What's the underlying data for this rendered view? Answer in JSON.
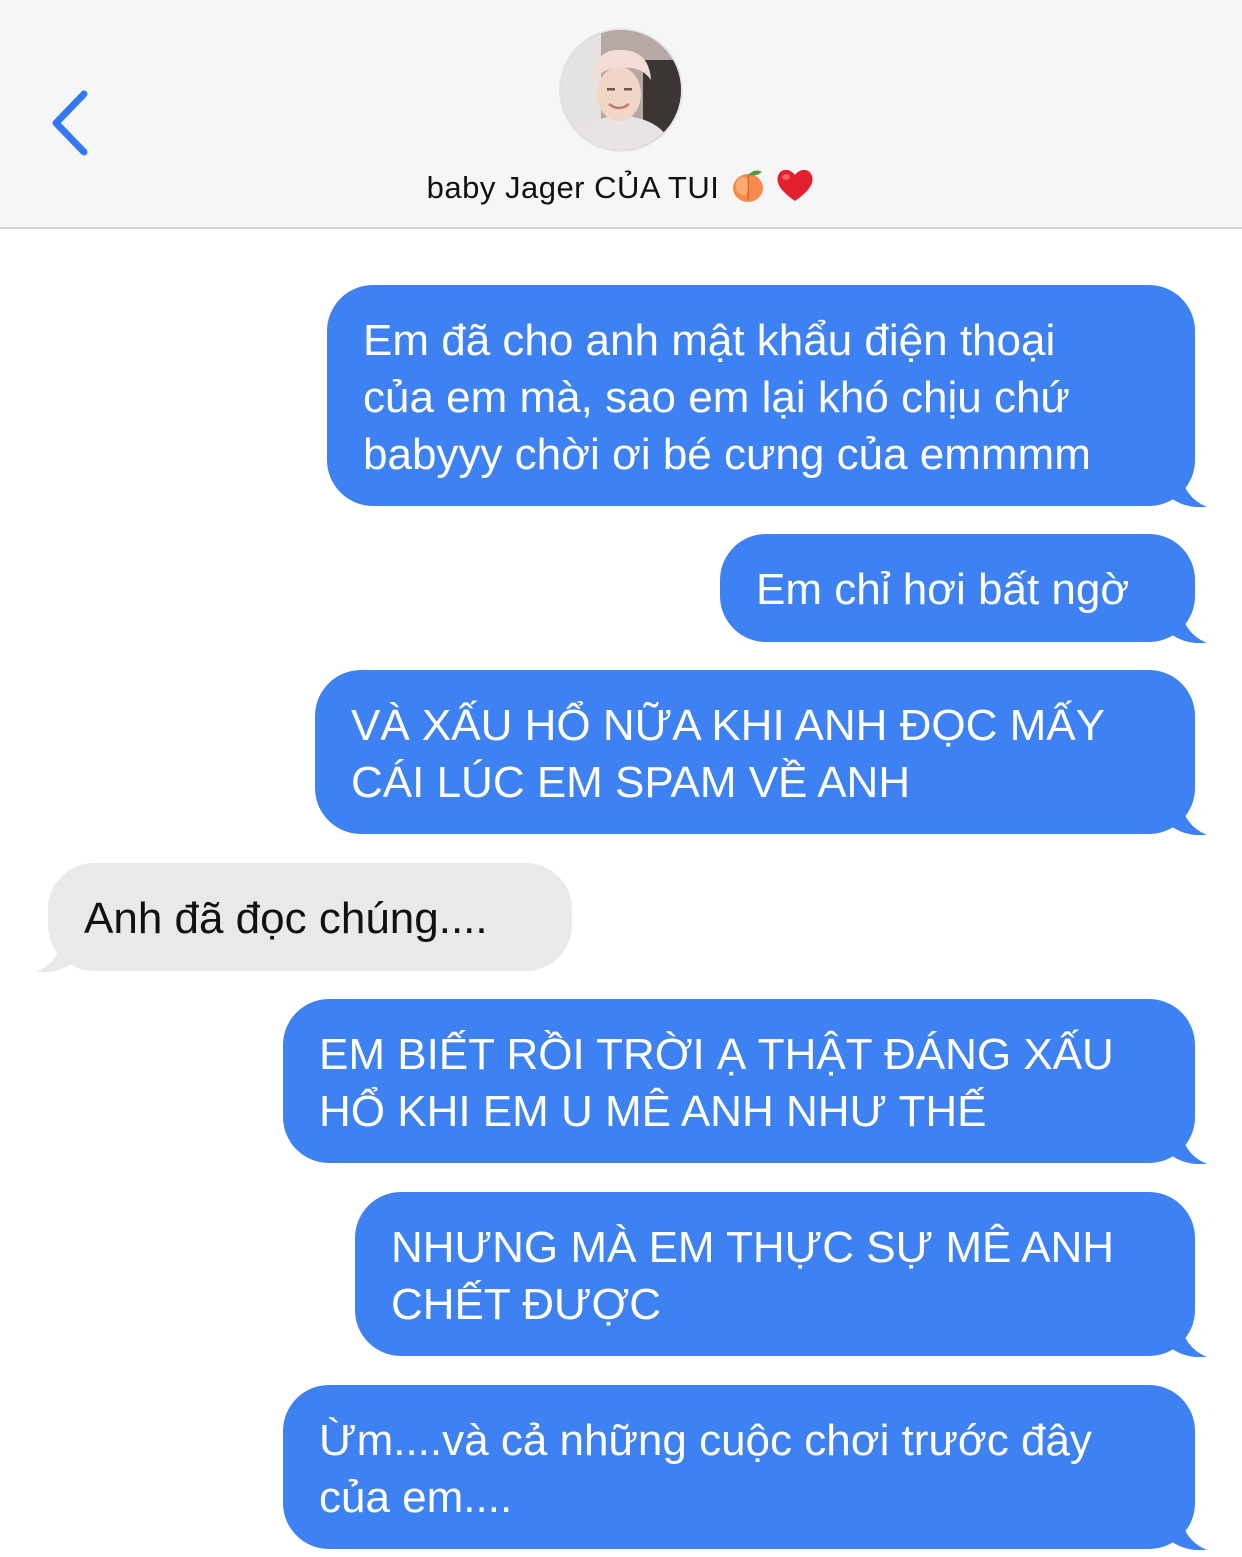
{
  "header": {
    "contact_name": "baby Jager CỦA TUI",
    "icons": [
      "back-chevron-icon",
      "avatar",
      "peach-emoji-icon",
      "red-heart-emoji-icon"
    ]
  },
  "colors": {
    "outgoing_bubble": "#3d81f2",
    "incoming_bubble": "#e9e9eb",
    "accent": "#3478f6"
  },
  "messages": [
    {
      "direction": "outgoing",
      "lines": [
        "Em đã cho anh mật khẩu điện thoại",
        "của em mà, sao em lại khó chịu chứ",
        "babyyy chời ơi bé cưng của emmmm"
      ]
    },
    {
      "direction": "outgoing",
      "lines": [
        "Em chỉ hơi bất ngờ"
      ]
    },
    {
      "direction": "outgoing",
      "lines": [
        "VÀ XẤU HỔ NỮA KHI ANH ĐỌC MẤY",
        "CÁI LÚC EM SPAM VỀ ANH"
      ]
    },
    {
      "direction": "incoming",
      "lines": [
        "Anh đã đọc chúng...."
      ]
    },
    {
      "direction": "outgoing",
      "lines": [
        "EM BIẾT RỒI TRỜI Ạ THẬT ĐÁNG XẤU",
        "HỔ KHI EM U MÊ ANH NHƯ THẾ"
      ]
    },
    {
      "direction": "outgoing",
      "lines": [
        "NHƯNG MÀ EM THỰC SỰ MÊ ANH",
        "CHẾT ĐƯỢC"
      ]
    },
    {
      "direction": "outgoing",
      "lines": [
        "Ừm....và cả những cuộc chơi trước đây",
        "của em...."
      ]
    }
  ]
}
